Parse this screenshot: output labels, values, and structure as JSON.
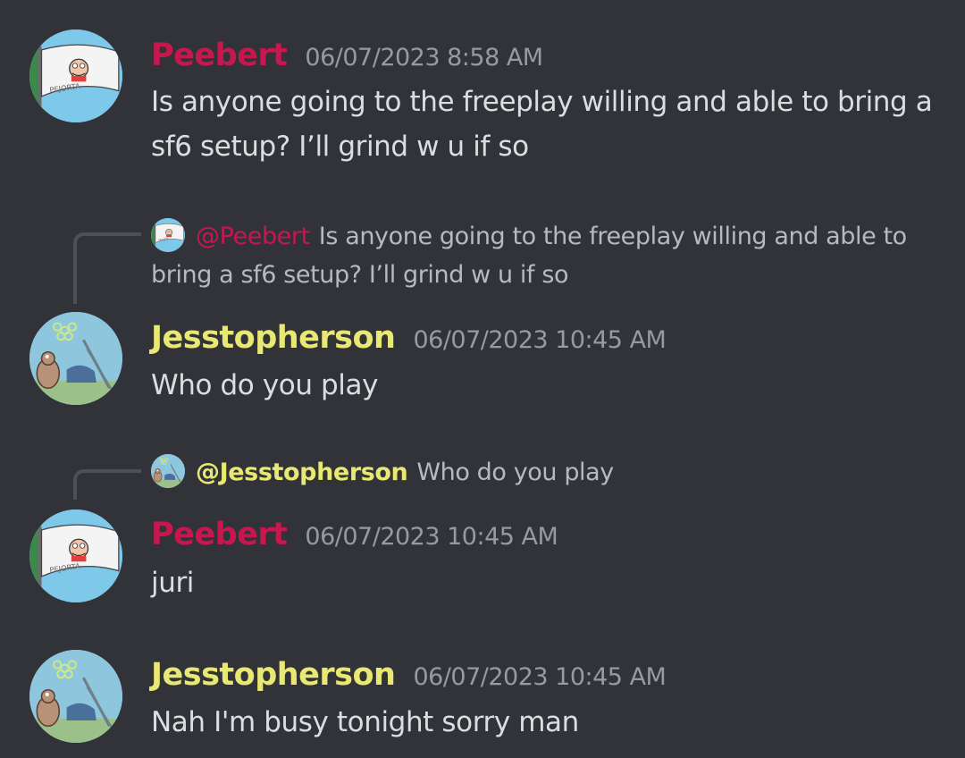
{
  "colors": {
    "background": "#313338",
    "peebert": "#c8174f",
    "jesstopherson": "#e8e872",
    "timestamp": "#949ba4",
    "message_text": "#dbdee1",
    "reply_text": "#b5bac1"
  },
  "messages": [
    {
      "author": "Peebert",
      "timestamp": "06/07/2023 8:58 AM",
      "text": "Is anyone going to the freeplay willing and able to bring a sf6 setup? I’ll grind w u if so",
      "avatar": "peter-flag-avatar",
      "avatar_flag_text": "PEJORTA"
    },
    {
      "reply_to": {
        "mention": "@Peebert",
        "text": "Is anyone going to the freeplay willing and able to bring a sf6 setup? I’ll grind w u if so"
      },
      "author": "Jesstopherson",
      "timestamp": "06/07/2023 10:45 AM",
      "text": "Who do you play",
      "avatar": "underwater-scene-avatar"
    },
    {
      "reply_to": {
        "mention": "@Jesstopherson",
        "text": "Who do you play"
      },
      "author": "Peebert",
      "timestamp": "06/07/2023 10:45 AM",
      "text": "juri",
      "avatar": "peter-flag-avatar",
      "avatar_flag_text": "PEJORTA"
    },
    {
      "author": "Jesstopherson",
      "timestamp": "06/07/2023 10:45 AM",
      "text": "Nah I'm busy tonight sorry man",
      "avatar": "underwater-scene-avatar"
    }
  ]
}
